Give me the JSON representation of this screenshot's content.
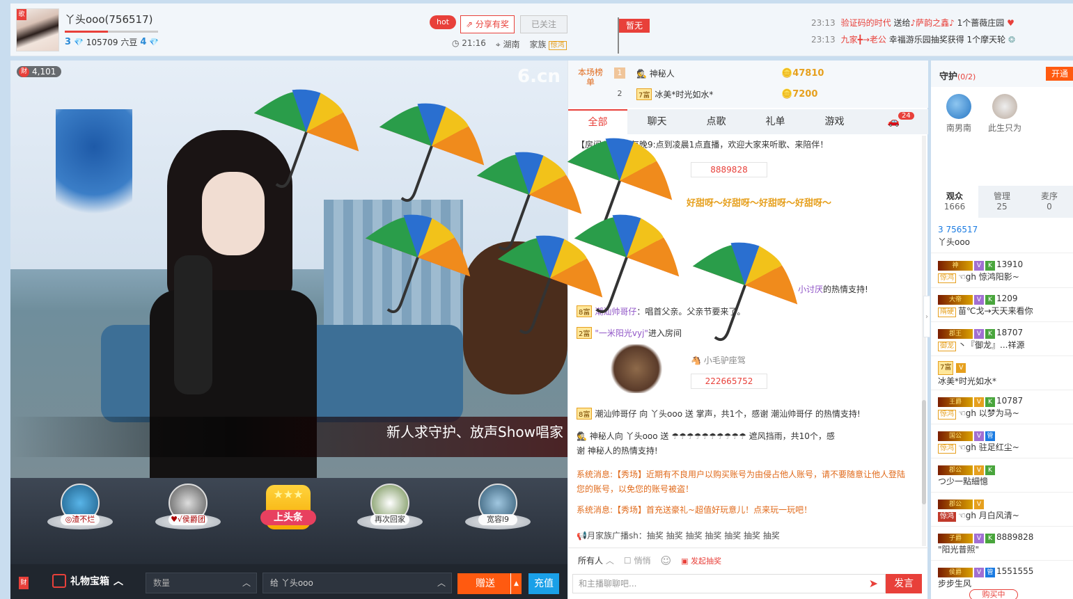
{
  "header": {
    "anchor_name": "丫头ooo(756517)",
    "progress_fraction": 0.46,
    "level_left": "3",
    "liudou": "105709 六豆",
    "level_right": "4",
    "hot_label": "hot",
    "share_label": "分享有奖",
    "follow_label": "已关注",
    "time": "21:16",
    "location": "湖南",
    "family_label": "家族",
    "family_tag": "惊鸿",
    "flag_label": "暂无",
    "notices": [
      {
        "time": "23:13",
        "user": "验证码的时代",
        "verb": "送给",
        "target": "♪萨韵之鑫♪",
        "tail": "1个蔷薇庄园"
      },
      {
        "time": "23:13",
        "user": "九家╋→老公",
        "verb": "幸福游乐园抽奖获得",
        "target": "",
        "tail": "1个摩天轮"
      }
    ]
  },
  "video": {
    "coin_icon": "财",
    "coin_count": "4,101",
    "logo": "6.cn",
    "marquee": "新人求守护、放声Show唱家"
  },
  "gift_strip": {
    "items": [
      {
        "label": "◎渣不烂"
      },
      {
        "label": "♥√侯爵团"
      },
      {
        "label": "上头条"
      },
      {
        "label": "再次回家"
      },
      {
        "label": "宽容l9"
      }
    ]
  },
  "bottom_bar": {
    "cai_icon": "财",
    "gift_box_label": "礼物宝箱",
    "qty_placeholder": "数量",
    "recipient": "给 丫头ooo",
    "send_label": "赠送",
    "charge_label": "充值"
  },
  "ranking": {
    "label": "本场榜单",
    "rows": [
      {
        "rank": "1",
        "name": "神秘人",
        "points": "47810"
      },
      {
        "rank": "2",
        "name": "冰美*时光如水*",
        "points": "7200"
      }
    ]
  },
  "chat_tabs": [
    "全部",
    "聊天",
    "点歌",
    "礼单",
    "游戏"
  ],
  "chat_tab_badge": "24",
  "chat": {
    "announcement": "【房间公告】：每晚9:点到凌晨1点直播，欢迎大家来听歌、来陪伴！",
    "box1": "8889828",
    "flood": "好甜呀～好甜呀～好甜呀～好甜呀～",
    "gift_thanks_tail": "的热情支持!",
    "gift_thanks_user": "小讨厌",
    "m1_user": "潮汕帅哥仔",
    "m1_text": "：唱首父亲。父亲节要来了。",
    "m2_user": "\"一米阳光vyj\"",
    "m2_text": "进入房间",
    "mount_label": "小毛驴座驾",
    "box2": "222665752",
    "m3": "潮汕帅哥仔 向 丫头ooo 送 掌声，共1个，感谢 潮汕帅哥仔 的热情支持!",
    "m4a": "神秘人向 丫头ooo 送 ☂☂☂☂☂☂☂☂☂☂ 遮风挡雨，共10个，感",
    "m4b": "谢 神秘人的热情支持!",
    "sys1_prefix": "系统消息:",
    "sys1a": "【秀场】近期有不良用户以购买账号为由侵占他人账号，请不要随意让他人登陆",
    "sys1b": "您的账号，以免您的账号被盗！",
    "sys2_prefix": "系统消息:",
    "sys2": "【秀场】首充送豪礼~超值好玩意儿！点来玩一玩吧！",
    "broadcast": "月家族广播sh：抽奖 抽奖 抽奖 抽奖 抽奖 抽奖 抽奖"
  },
  "chat_controls": {
    "target": "所有人",
    "whisper": "悄悄",
    "lottery": "发起抽奖",
    "input_placeholder": "和主播聊聊吧...",
    "speak_label": "发言"
  },
  "sidebar": {
    "guard_title": "守护",
    "guard_count": "(0/2)",
    "open_label": "开通",
    "guards": [
      "南男南",
      "此生只为"
    ],
    "tabs": [
      {
        "label": "观众",
        "count": "1666"
      },
      {
        "label": "管理",
        "count": "25"
      },
      {
        "label": "麦序",
        "count": "0"
      }
    ],
    "audience": [
      {
        "line1": "3 756517",
        "line2": "丫头ooo"
      },
      {
        "line1": "13910",
        "tag": "惊鸿",
        "line2": "☜gh 惊鸿阳影~"
      },
      {
        "line1": "1209",
        "tag": "隋硬",
        "line2": "苗℃戈→天天来看你"
      },
      {
        "line1": "18707",
        "tag": "御龙",
        "line2": "丶『御龙』...祥源"
      },
      {
        "line1": "",
        "tag": "",
        "line2": "冰美*时光如水*"
      },
      {
        "line1": "10787",
        "tag": "惊鸿",
        "line2": "☜gh 以梦为马~"
      },
      {
        "line1": "",
        "tag": "惊鸿",
        "line2": "☜gh 驻足红尘~"
      },
      {
        "line1": "",
        "tag": "",
        "line2": "つ少一點細憶"
      },
      {
        "line1": "",
        "tag": "惊鸿",
        "line2": "☜gh 月白风清~"
      },
      {
        "line1": "8889828",
        "tag": "",
        "line2": "\"阳光普照\""
      },
      {
        "line1": "1551555",
        "tag": "",
        "line2": "步步生风"
      }
    ],
    "buy_label": "购买中"
  }
}
